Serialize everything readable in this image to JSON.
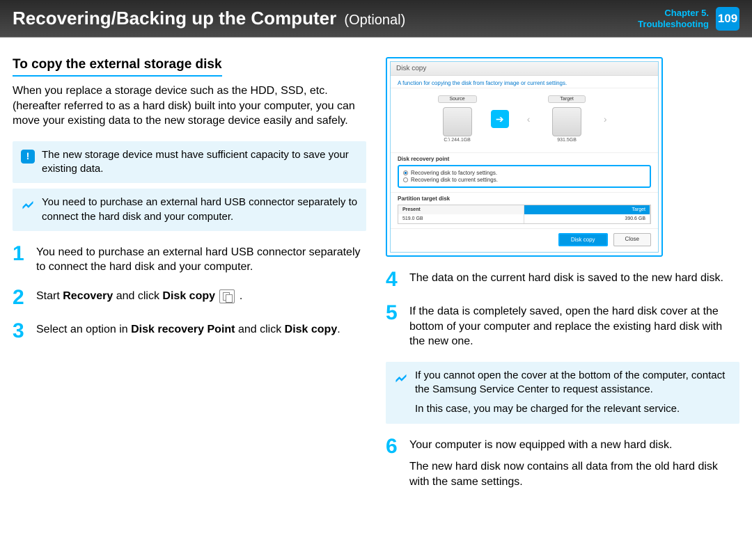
{
  "header": {
    "title_main": "Recovering/Backing up the Computer",
    "title_sub": "(Optional)",
    "chapter_line1": "Chapter 5.",
    "chapter_line2": "Troubleshooting",
    "page_number": "109"
  },
  "left": {
    "heading": "To copy the external storage disk",
    "intro": "When you replace a storage device such as the HDD, SSD, etc. (hereafter referred to as a hard disk) built into your computer, you can move your existing data to the new storage device easily and safely.",
    "alert": "The new storage device must have sufficient capacity to save your existing data.",
    "note": "You need to purchase an external hard USB connector separately to connect the hard disk and your computer.",
    "step1": "You need to purchase an external hard USB connector separately to connect the hard disk and your computer.",
    "step2_pre": "Start ",
    "step2_b1": "Recovery",
    "step2_mid": " and click ",
    "step2_b2": "Disk copy",
    "step2_post": " .",
    "step3_pre": "Select an option in ",
    "step3_b1": "Disk recovery Point",
    "step3_mid": " and click ",
    "step3_b2": "Disk copy",
    "step3_post": "."
  },
  "shot": {
    "title": "Disk copy",
    "desc": "A function for copying the disk from factory image or current settings.",
    "source_label": "Source",
    "target_label": "Target",
    "source_cap": "C:\\ 244.1GB",
    "target_cap": "931.5GB",
    "recovery_heading": "Disk recovery point",
    "opt1": "Recovering disk to factory settings.",
    "opt2": "Recovering disk to current settings.",
    "partition_heading": "Partition target disk",
    "partition_present": "Present",
    "partition_left": "519.0 GB",
    "partition_right_label": "Target",
    "partition_right": "390.6 GB",
    "btn_primary": "Disk copy",
    "btn_close": "Close"
  },
  "right": {
    "step4": "The data on the current hard disk is saved to the new hard disk.",
    "step5": "If the data is completely saved, open the hard disk cover at the bottom of your computer and replace the existing hard disk with the new one.",
    "note_line1": "If you cannot open the cover at the bottom of the computer, contact the Samsung Service Center to request assistance.",
    "note_line2": "In this case, you may be charged for the relevant service.",
    "step6_line1": "Your computer is now equipped with a new hard disk.",
    "step6_line2": "The new hard disk now contains all data from the old hard disk with the same settings."
  }
}
